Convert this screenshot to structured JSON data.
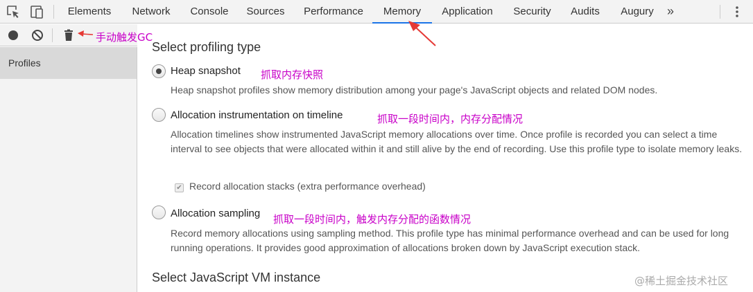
{
  "tabs": [
    {
      "label": "Elements",
      "active": false
    },
    {
      "label": "Network",
      "active": false
    },
    {
      "label": "Console",
      "active": false
    },
    {
      "label": "Sources",
      "active": false
    },
    {
      "label": "Performance",
      "active": false
    },
    {
      "label": "Memory",
      "active": true
    },
    {
      "label": "Application",
      "active": false
    },
    {
      "label": "Security",
      "active": false
    },
    {
      "label": "Audits",
      "active": false
    },
    {
      "label": "Augury",
      "active": false
    }
  ],
  "more_tabs": "»",
  "toolbar": {
    "icons": [
      "record-icon",
      "clear-icon",
      "collect-garbage-icon"
    ]
  },
  "sidebar": {
    "items": [
      {
        "label": "Profiles"
      }
    ]
  },
  "main": {
    "heading": "Select profiling type",
    "options": [
      {
        "label": "Heap snapshot",
        "checked": true,
        "description": "Heap snapshot profiles show memory distribution among your page's JavaScript objects and related DOM nodes."
      },
      {
        "label": "Allocation instrumentation on timeline",
        "checked": false,
        "description": "Allocation timelines show instrumented JavaScript memory allocations over time. Once profile is recorded you can select a time interval to see objects that were allocated within it and still alive by the end of recording. Use this profile type to isolate memory leaks.",
        "checkbox_label": "Record allocation stacks (extra performance overhead)",
        "checkbox_checked": true
      },
      {
        "label": "Allocation sampling",
        "checked": false,
        "description": "Record memory allocations using sampling method. This profile type has minimal performance overhead and can be used for long running operations. It provides good approximation of allocations broken down by JavaScript execution stack."
      }
    ],
    "vm_heading": "Select JavaScript VM instance"
  },
  "annotations": {
    "gc": "手动触发GC",
    "heap": "抓取内存快照",
    "timeline": "抓取一段时间内，内存分配情况",
    "sampling": "抓取一段时间内，触发内存分配的函数情况"
  },
  "watermark": "@稀土掘金技术社区",
  "colors": {
    "accent": "#1a73e8",
    "annotation": "#c800c8",
    "arrow": "#e53935",
    "panel_bg": "#f3f3f3"
  }
}
